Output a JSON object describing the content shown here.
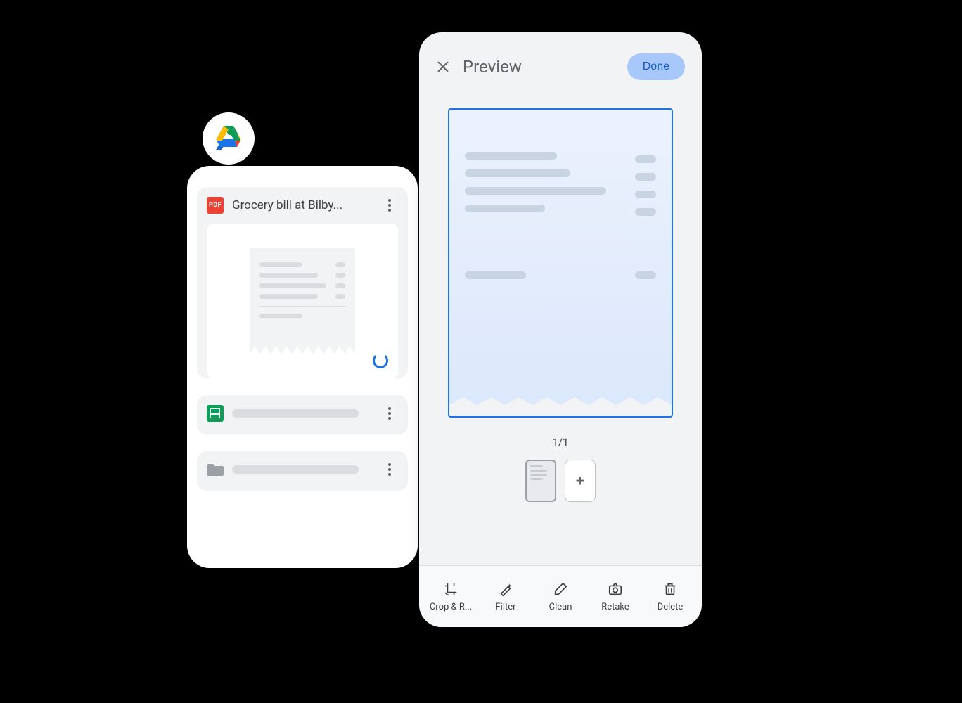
{
  "drive": {
    "files": [
      {
        "type": "pdf",
        "title": "Grocery bill at Bilby...",
        "icon_label": "PDF"
      },
      {
        "type": "sheets",
        "title": ""
      },
      {
        "type": "folder",
        "title": ""
      }
    ]
  },
  "preview": {
    "title": "Preview",
    "done_label": "Done",
    "page_indicator": "1/1",
    "add_label": "+",
    "toolbar": [
      {
        "id": "crop",
        "label": "Crop & R...",
        "icon": "crop-rotate-icon"
      },
      {
        "id": "filter",
        "label": "Filter",
        "icon": "magic-wand-icon"
      },
      {
        "id": "clean",
        "label": "Clean",
        "icon": "eraser-icon"
      },
      {
        "id": "retake",
        "label": "Retake",
        "icon": "camera-icon"
      },
      {
        "id": "delete",
        "label": "Delete",
        "icon": "trash-icon"
      }
    ]
  },
  "colors": {
    "accent": "#1a73e8",
    "done_bg": "#a8c7fa",
    "done_fg": "#0b57d0"
  }
}
